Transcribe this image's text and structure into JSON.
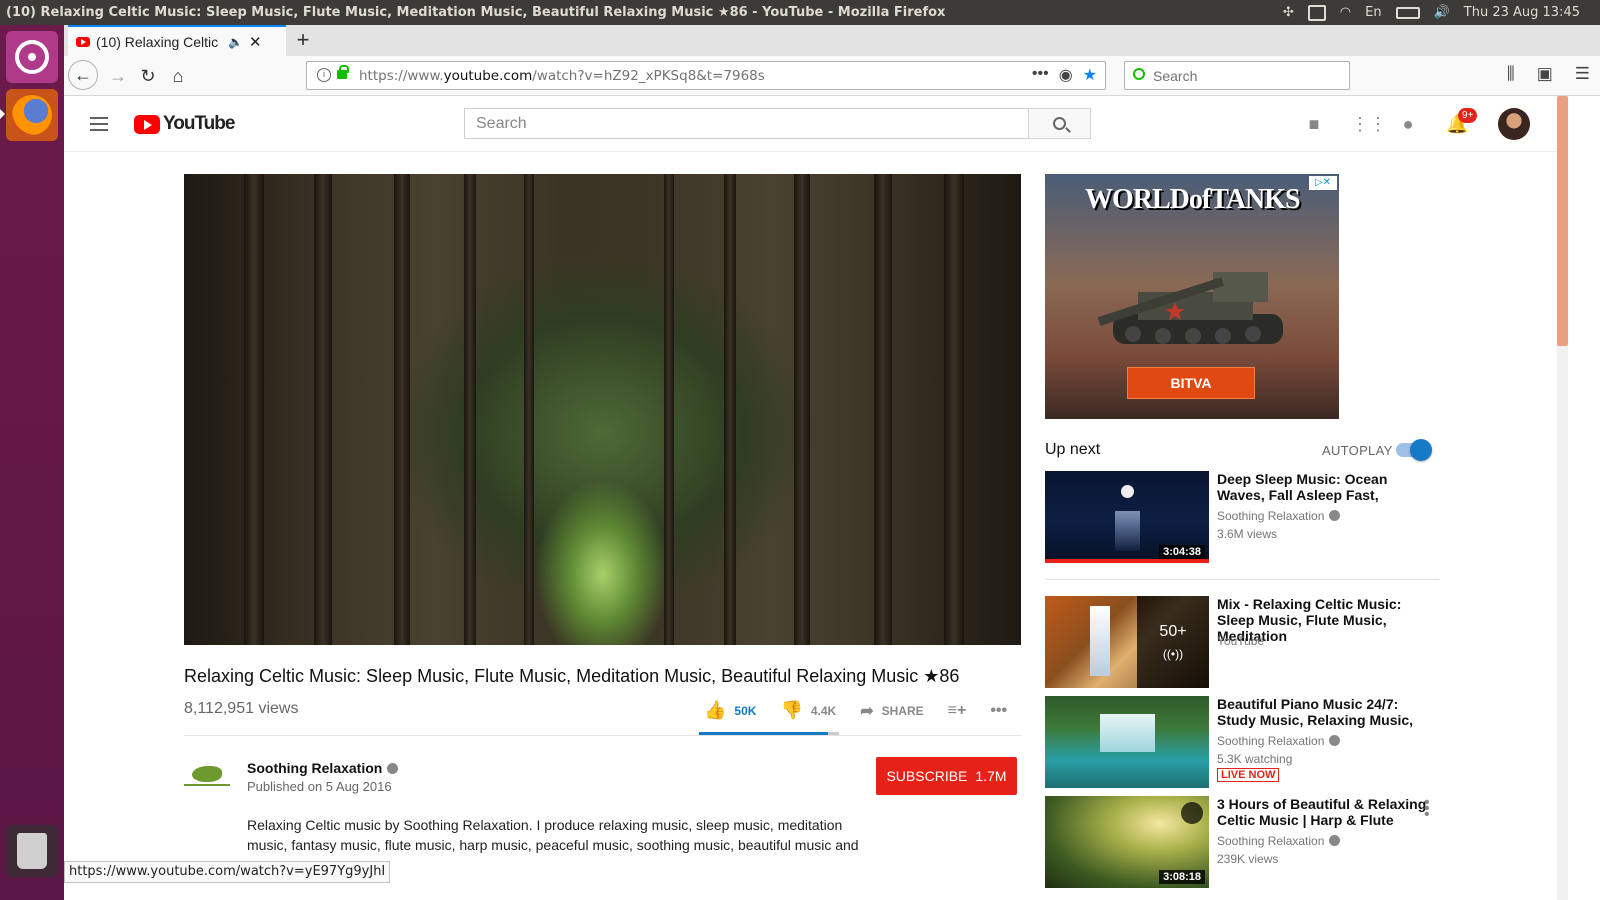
{
  "os": {
    "window_title": "(10) Relaxing Celtic Music: Sleep Music, Flute Music, Meditation Music, Beautiful Relaxing Music ★86 - YouTube - Mozilla Firefox",
    "clock": "Thu 23 Aug 13:45",
    "keyboard_layout": "En"
  },
  "browser": {
    "tab_title": "(10) Relaxing Celtic M",
    "url_prefix": "https://www.",
    "url_domain": "youtube.com",
    "url_path": "/watch?v=hZ92_xPKSq8&t=7968s",
    "search_placeholder": "Search",
    "status_url": "https://www.youtube.com/watch?v=yE97Yg9yJhI"
  },
  "youtube": {
    "logo_text": "YouTube",
    "search_placeholder": "Search",
    "notification_count": "9+"
  },
  "video": {
    "title": "Relaxing Celtic Music: Sleep Music, Flute Music, Meditation Music, Beautiful Relaxing Music ★86",
    "views": "8,112,951 views",
    "likes": "50K",
    "dislikes": "4.4K",
    "share_label": "SHARE",
    "like_ratio": 0.92
  },
  "channel": {
    "name": "Soothing Relaxation",
    "published": "Published on 5 Aug 2016",
    "subscribe_label": "SUBSCRIBE",
    "subscriber_count": "1.7M",
    "description": "Relaxing Celtic music by Soothing Relaxation. I produce relaxing music, sleep music, meditation music, fantasy music, flute music, harp music, peaceful music, soothing music, beautiful music and"
  },
  "ad": {
    "brand": "WORLDofTANKS",
    "cta": "BITVA"
  },
  "sidebar": {
    "upnext_label": "Up next",
    "autoplay_label": "AUTOPLAY",
    "recommendations": [
      {
        "title": "Deep Sleep Music: Ocean Waves, Fall Asleep Fast,",
        "channel": "Soothing Relaxation",
        "meta": "3.6M views",
        "duration": "3:04:38"
      },
      {
        "title": "Mix - Relaxing Celtic Music: Sleep Music, Flute Music, Meditation",
        "channel": "YouTube",
        "mix_count": "50+"
      },
      {
        "title": "Beautiful Piano Music 24/7: Study Music, Relaxing Music,",
        "channel": "Soothing Relaxation",
        "meta": "5.3K watching",
        "live": "LIVE NOW"
      },
      {
        "title": "3 Hours of Beautiful & Relaxing Celtic Music | Harp & Flute",
        "channel": "Soothing Relaxation",
        "meta": "239K views",
        "duration": "3:08:18"
      }
    ]
  }
}
